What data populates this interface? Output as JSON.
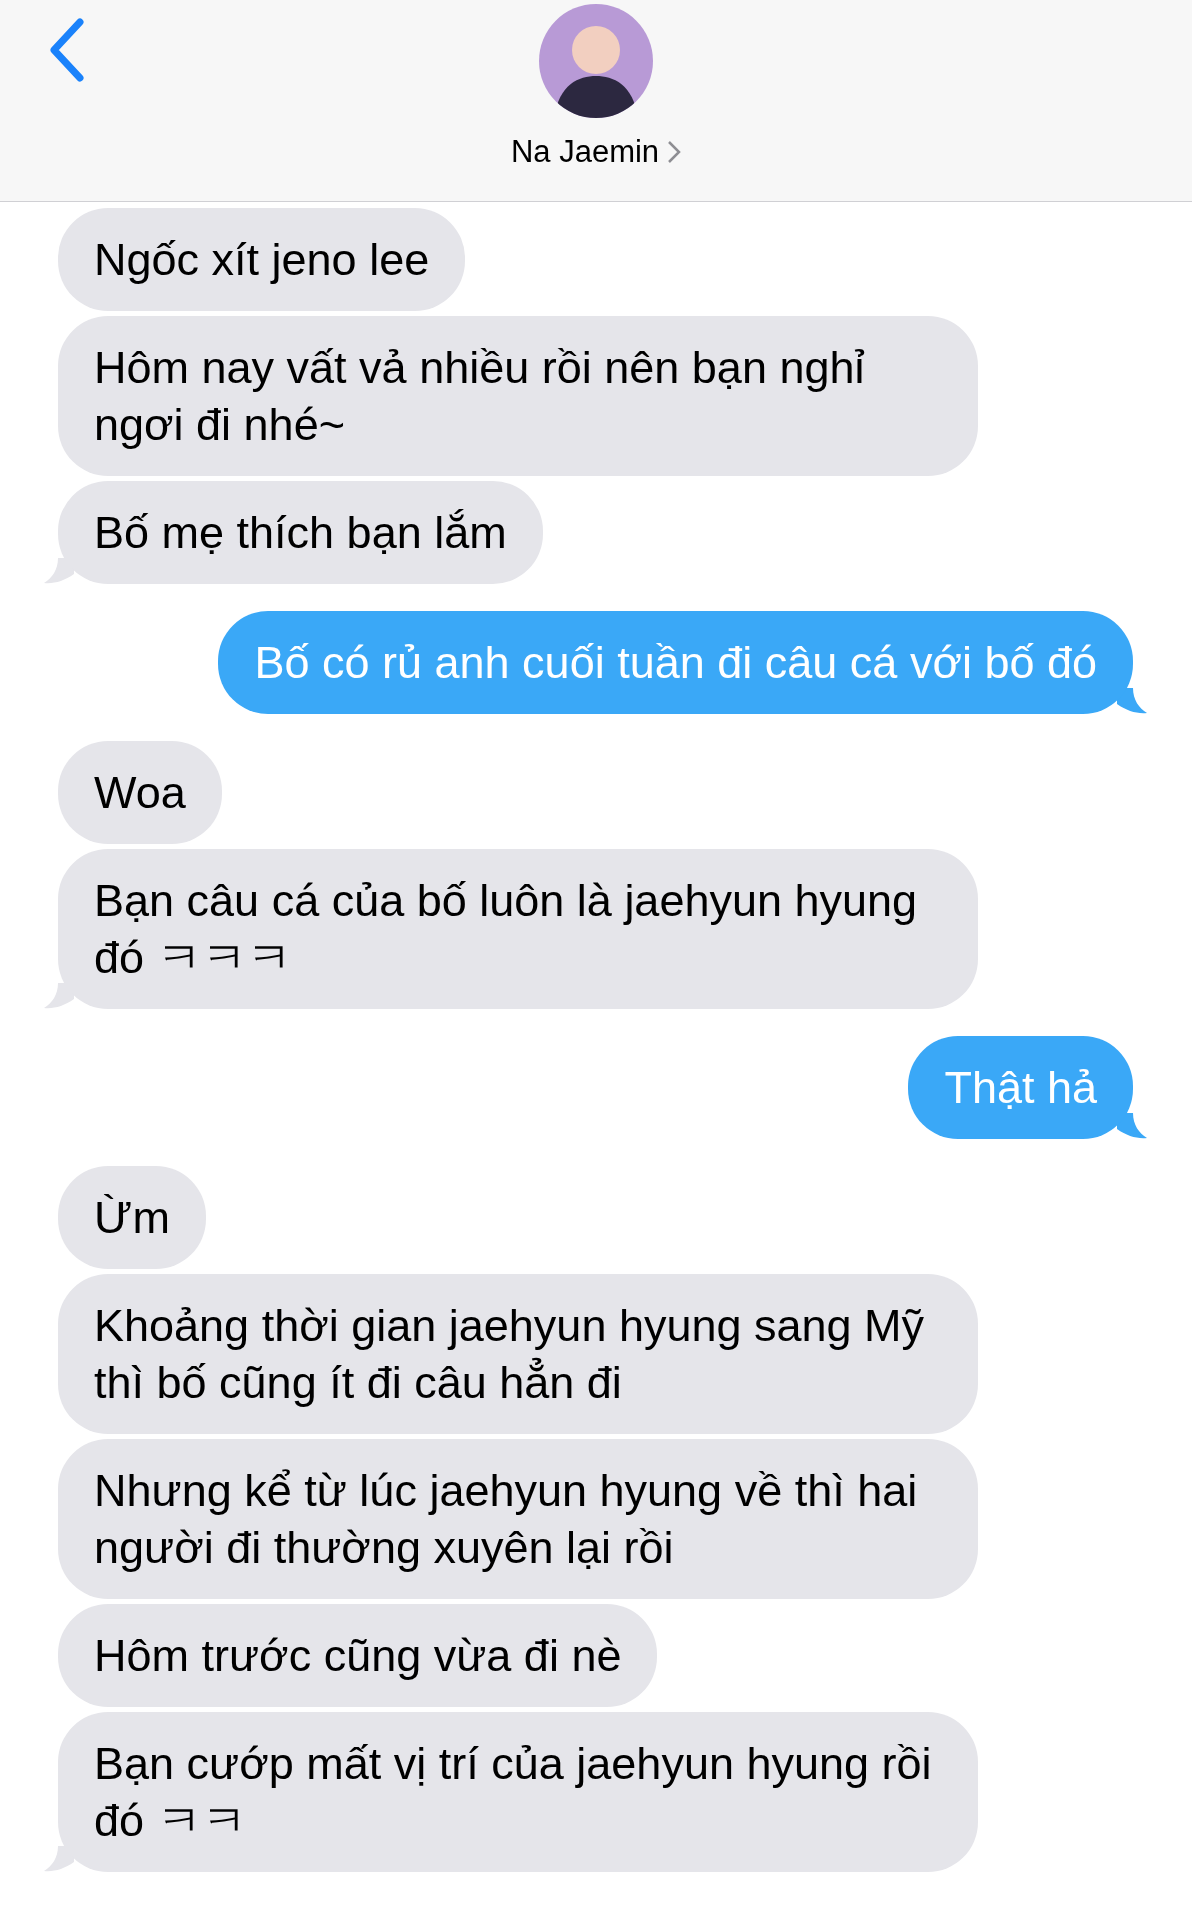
{
  "header": {
    "contact_name": "Na Jaemin"
  },
  "messages": [
    {
      "kind": "received",
      "text": "Ngốc xít jeno lee",
      "tail": false
    },
    {
      "kind": "received",
      "text": "Hôm nay vất vả nhiều rồi nên bạn nghỉ ngơi đi nhé~",
      "tail": false
    },
    {
      "kind": "received",
      "text": "Bố mẹ thích bạn lắm",
      "tail": true
    },
    {
      "kind": "sent",
      "text": "Bố có rủ anh cuối tuần đi câu cá với bố đó",
      "tail": true
    },
    {
      "kind": "received",
      "text": "Woa",
      "tail": false
    },
    {
      "kind": "received",
      "text": "Bạn câu cá của bố luôn là jaehyun hyung đó ㅋㅋㅋ",
      "tail": true
    },
    {
      "kind": "sent",
      "text": "Thật hả",
      "tail": true
    },
    {
      "kind": "received",
      "text": "Ừm",
      "tail": false
    },
    {
      "kind": "received",
      "text": "Khoảng thời gian jaehyun hyung sang Mỹ thì bố cũng ít đi câu hẳn đi",
      "tail": false
    },
    {
      "kind": "received",
      "text": "Nhưng kể từ lúc jaehyun hyung về thì hai người đi thường xuyên lại rồi",
      "tail": false
    },
    {
      "kind": "received",
      "text": "Hôm trước cũng vừa đi nè",
      "tail": false
    },
    {
      "kind": "received",
      "text": "Bạn cướp mất vị trí của jaehyun hyung rồi đó ㅋㅋ",
      "tail": true
    }
  ]
}
